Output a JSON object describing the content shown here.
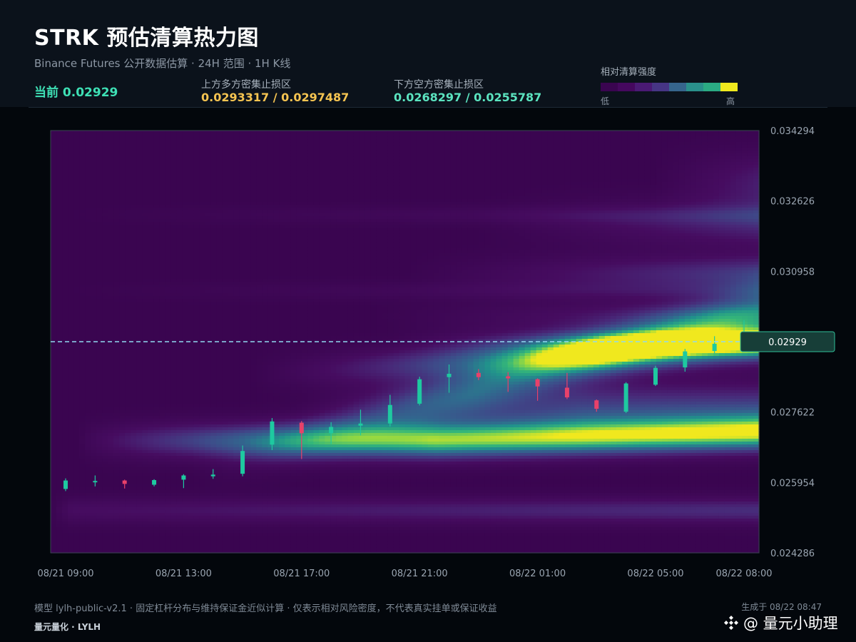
{
  "header": {
    "title": "STRK 预估清算热力图",
    "subtitle": "Binance Futures 公开数据估算 · 24H 范围 · 1H K线",
    "current_label": "当前 0.02929",
    "upper_zone": {
      "label": "上方多方密集止损区",
      "value": "0.0293317 / 0.0297487",
      "color": "#f5c451"
    },
    "lower_zone": {
      "label": "下方空方密集止损区",
      "value": "0.0268297 / 0.0255787",
      "color": "#5be3bf"
    },
    "legend": {
      "title": "相对清算强度",
      "low": "低",
      "high": "高",
      "colors": [
        "#3a0550",
        "#45085e",
        "#4a1a74",
        "#463584",
        "#36658d",
        "#2a908b",
        "#2bab83",
        "#f0e91e"
      ]
    }
  },
  "chart_data": {
    "type": "heatmap",
    "y_axis": {
      "range": [
        0.024286,
        0.034294
      ],
      "ticks": [
        "0.034294",
        "0.032626",
        "0.030958",
        "0.027622",
        "0.025954",
        "0.024286"
      ]
    },
    "x_axis": {
      "ticks": [
        "08/21 09:00",
        "08/21 13:00",
        "08/21 17:00",
        "08/21 21:00",
        "08/22 01:00",
        "08/22 05:00",
        "08/22 08:00"
      ]
    },
    "current_price": 0.02929,
    "current_price_label": "0.02929",
    "colors": {
      "up": "#1ec9a0",
      "down": "#e8416a",
      "price_line": "#8fd9ef"
    },
    "candles": [
      {
        "o": 0.0258,
        "c": 0.026,
        "h": 0.02605,
        "l": 0.02575
      },
      {
        "o": 0.02596,
        "c": 0.02599,
        "h": 0.02612,
        "l": 0.02586
      },
      {
        "o": 0.026,
        "c": 0.02592,
        "h": 0.02602,
        "l": 0.02581
      },
      {
        "o": 0.0259,
        "c": 0.02601,
        "h": 0.02603,
        "l": 0.02586
      },
      {
        "o": 0.02602,
        "c": 0.02612,
        "h": 0.02615,
        "l": 0.02582
      },
      {
        "o": 0.0261,
        "c": 0.02614,
        "h": 0.02627,
        "l": 0.02604
      },
      {
        "o": 0.02616,
        "c": 0.0267,
        "h": 0.02683,
        "l": 0.0261
      },
      {
        "o": 0.02685,
        "c": 0.0274,
        "h": 0.02748,
        "l": 0.02672
      },
      {
        "o": 0.02737,
        "c": 0.02712,
        "h": 0.02741,
        "l": 0.02651
      },
      {
        "o": 0.02712,
        "c": 0.02727,
        "h": 0.02738,
        "l": 0.02686
      },
      {
        "o": 0.0273,
        "c": 0.02735,
        "h": 0.02768,
        "l": 0.02707
      },
      {
        "o": 0.02735,
        "c": 0.02779,
        "h": 0.02803,
        "l": 0.02728
      },
      {
        "o": 0.02782,
        "c": 0.0284,
        "h": 0.02846,
        "l": 0.02778
      },
      {
        "o": 0.02845,
        "c": 0.02853,
        "h": 0.02875,
        "l": 0.02808
      },
      {
        "o": 0.02855,
        "c": 0.02845,
        "h": 0.02864,
        "l": 0.02838
      },
      {
        "o": 0.02847,
        "c": 0.02842,
        "h": 0.02857,
        "l": 0.0281
      },
      {
        "o": 0.0284,
        "c": 0.02823,
        "h": 0.02842,
        "l": 0.02789
      },
      {
        "o": 0.0282,
        "c": 0.02797,
        "h": 0.02855,
        "l": 0.02793
      },
      {
        "o": 0.0279,
        "c": 0.0277,
        "h": 0.02792,
        "l": 0.02763
      },
      {
        "o": 0.02763,
        "c": 0.0283,
        "h": 0.02833,
        "l": 0.0276
      },
      {
        "o": 0.02827,
        "c": 0.02867,
        "h": 0.02872,
        "l": 0.02824
      },
      {
        "o": 0.02868,
        "c": 0.02906,
        "h": 0.02912,
        "l": 0.02858
      },
      {
        "o": 0.02907,
        "c": 0.02924,
        "h": 0.02942,
        "l": 0.02902
      },
      {
        "o": 0.02919,
        "c": 0.02929,
        "h": 0.0298,
        "l": 0.02911
      }
    ]
  },
  "footer": {
    "note": "模型 lylh-public-v2.1 · 固定杠杆分布与维持保证金近似计算 · 仅表示相对风险密度，不代表真实挂单或保证收益",
    "generated": "生成于 08/22 08:47",
    "brand": "量元量化 · LYLH",
    "watermark": "@ 量元小助理"
  }
}
